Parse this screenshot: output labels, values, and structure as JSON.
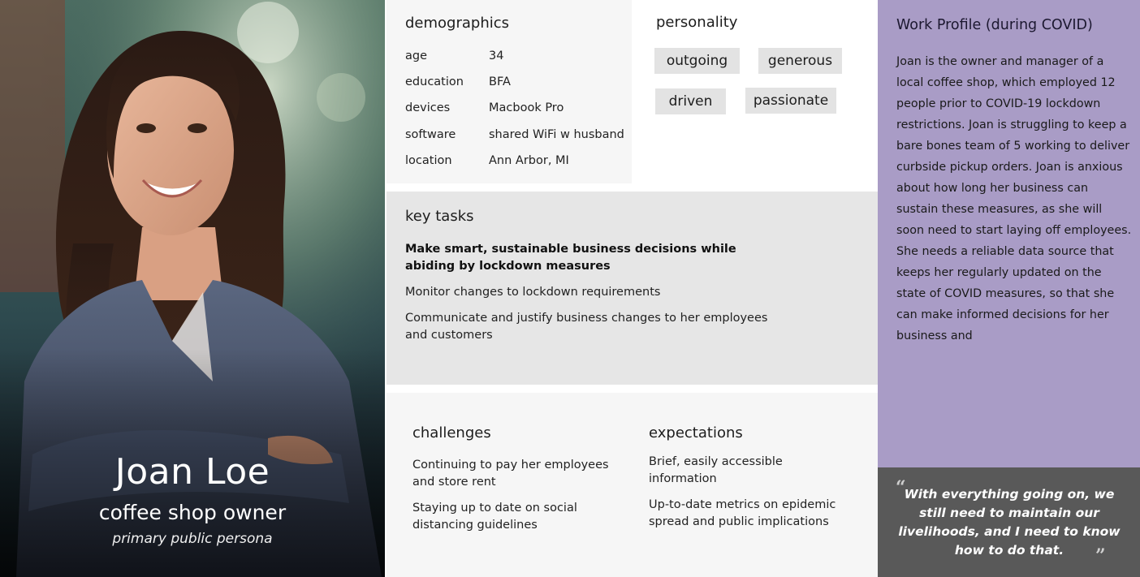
{
  "persona": {
    "name": "Joan Loe",
    "role": "coffee shop owner",
    "type": "primary public persona"
  },
  "demographics": {
    "title": "demographics",
    "rows": [
      {
        "label": "age",
        "value": "34"
      },
      {
        "label": "education",
        "value": "BFA"
      },
      {
        "label": "devices",
        "value": "Macbook Pro"
      },
      {
        "label": "software",
        "value": "shared WiFi w husband"
      },
      {
        "label": "location",
        "value": "Ann Arbor, MI"
      }
    ]
  },
  "personality": {
    "title": "personality",
    "tags": [
      "outgoing",
      "generous",
      "driven",
      "passionate"
    ]
  },
  "key_tasks": {
    "title": "key tasks",
    "items": [
      "Make smart, sustainable business decisions while abiding by lockdown measures",
      "Monitor changes to lockdown requirements",
      "Communicate and justify business changes to her employees and customers"
    ]
  },
  "challenges": {
    "title": "challenges",
    "items": [
      "Continuing to pay her employees and store rent",
      "Staying up to date on social distancing guidelines"
    ]
  },
  "expectations": {
    "title": "expectations",
    "items": [
      "Brief, easily accessible information",
      "Up-to-date metrics on epidemic spread and public implications"
    ]
  },
  "work_profile": {
    "title": "Work Profile (during COVID)",
    "text": "Joan is the owner and manager of a local coffee shop, which employed 12 people prior to COVID-19 lockdown restrictions. Joan is struggling to keep a bare bones team of 5 working to deliver curbside pickup orders. Joan is anxious about how long her business can sustain these measures, as she will soon need to start laying off employees. She needs a reliable data source that keeps her regularly updated on the state of COVID measures, so that she can make informed decisions for her business and"
  },
  "quote": {
    "text": "With everything going on, we still need to maintain our livelihoods, and I need to know how to do that.",
    "open_mark": "“",
    "close_mark": "”"
  },
  "colors": {
    "profile_bg": "#a99cc6",
    "quote_bg": "#595959",
    "tasks_bg": "#e6e6e6",
    "tag_bg": "#e3e3e3"
  }
}
